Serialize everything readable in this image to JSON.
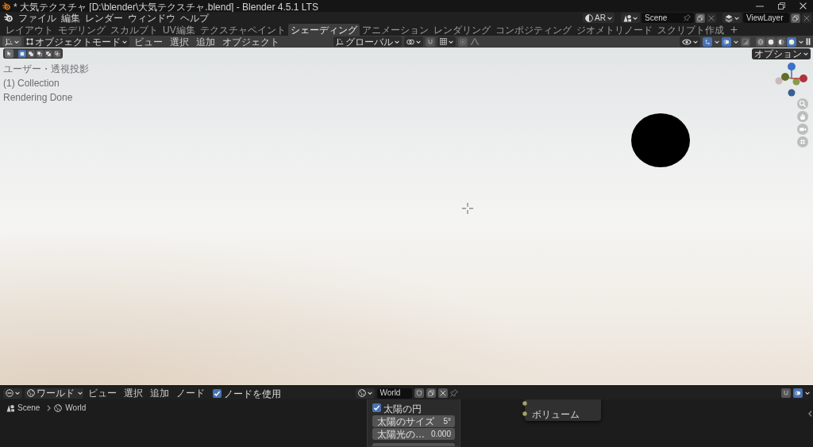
{
  "window": {
    "title": "* 大気テクスチャ [D:\\blender\\大気テクスチャ.blend] - Blender 4.5.1 LTS"
  },
  "menus": [
    "ファイル",
    "編集",
    "レンダー",
    "ウィンドウ",
    "ヘルプ"
  ],
  "workspace_tabs": [
    {
      "label": "レイアウト",
      "selected": false
    },
    {
      "label": "モデリング",
      "selected": false
    },
    {
      "label": "スカルプト",
      "selected": false
    },
    {
      "label": "UV編集",
      "selected": false
    },
    {
      "label": "テクスチャペイント",
      "selected": false
    },
    {
      "label": "シェーディング",
      "selected": true
    },
    {
      "label": "アニメーション",
      "selected": false
    },
    {
      "label": "レンダリング",
      "selected": false
    },
    {
      "label": "コンポジティング",
      "selected": false
    },
    {
      "label": "ジオメトリノード",
      "selected": false
    },
    {
      "label": "スクリプト作成",
      "selected": false
    }
  ],
  "topbar_right": {
    "engine": "AR",
    "scene": "Scene",
    "view_layer": "ViewLayer"
  },
  "viewport_header": {
    "mode": "オブジェクトモード",
    "menus": [
      "ビュー",
      "選択",
      "追加",
      "オブジェクト"
    ],
    "orientation": "グローバル",
    "center_toggles": [
      {
        "kind": "snap",
        "on": false
      },
      {
        "kind": "proportional",
        "on": false
      }
    ],
    "display_toggles": [
      {
        "kind": "gizmos",
        "on": true
      },
      {
        "kind": "overlays",
        "on": true
      },
      {
        "kind": "xray",
        "on": false
      }
    ],
    "shading": [
      {
        "kind": "wireframe",
        "selected": false
      },
      {
        "kind": "solid",
        "selected": false
      },
      {
        "kind": "material",
        "selected": false
      },
      {
        "kind": "rendered",
        "selected": true
      }
    ]
  },
  "viewport": {
    "tools": [
      {
        "kind": "select_box",
        "selected": true
      }
    ],
    "select_modes": [
      {
        "kind": "set",
        "selected": true
      },
      {
        "kind": "extend",
        "selected": false
      },
      {
        "kind": "subtract",
        "selected": false
      },
      {
        "kind": "difference",
        "selected": false
      },
      {
        "kind": "intersect",
        "selected": false
      }
    ],
    "options": "オプション",
    "overlay_lines": [
      "ユーザー・透視投影",
      "(1) Collection",
      "Rendering Done"
    ]
  },
  "node_header": {
    "data_type": "ワールド",
    "menus": [
      "ビュー",
      "選択",
      "追加",
      "ノード"
    ],
    "use_nodes": {
      "label": "ノードを使用",
      "checked": true
    },
    "world": "World",
    "toggles": [
      {
        "kind": "snap",
        "on": false
      },
      {
        "kind": "overlays",
        "on": true
      }
    ]
  },
  "breadcrumbs": [
    {
      "kind": "scene",
      "label": "Scene"
    },
    {
      "kind": "world",
      "label": "World"
    }
  ],
  "sun_panel": {
    "sun_disc": {
      "label": "太陽の円",
      "checked": true
    },
    "fields": [
      {
        "label": "太陽のサイズ",
        "value": "5°"
      },
      {
        "label": "太陽光の…",
        "value": "0.000"
      }
    ]
  },
  "output_node": {
    "sockets": [
      "ボリューム"
    ]
  }
}
